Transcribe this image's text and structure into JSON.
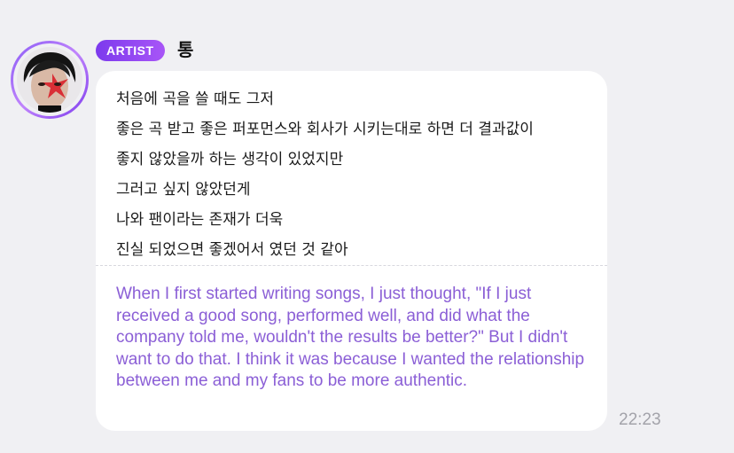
{
  "message": {
    "badge": "ARTIST",
    "author": "통",
    "korean_lines": [
      "처음에 곡을 쓸 때도 그저",
      "좋은 곡 받고 좋은 퍼포먼스와 회사가 시키는대로 하면 더 결과값이",
      "좋지 않았을까 하는 생각이 있었지만",
      "그러고 싶지 않았던게",
      "나와 팬이라는 존재가 더욱",
      "진실 되었으면 좋겠어서 였던 것 같아"
    ],
    "translation": "When I first started writing songs, I just thought, \"If I just received a good song, performed well, and did what the company told me, wouldn't the results be better?\" But I didn't want to do that. I think it was because I wanted the relationship between me and my fans to be more authentic.",
    "time": "22:23"
  },
  "colors": {
    "badge_gradient_start": "#7c3aed",
    "badge_gradient_end": "#a855f7",
    "translation_text": "#8b5fd6",
    "bubble_background": "#ffffff",
    "page_background": "#f0f0f3",
    "timestamp_text": "#a3a3aa"
  },
  "icons": {
    "avatar": "artist-profile-photo"
  }
}
